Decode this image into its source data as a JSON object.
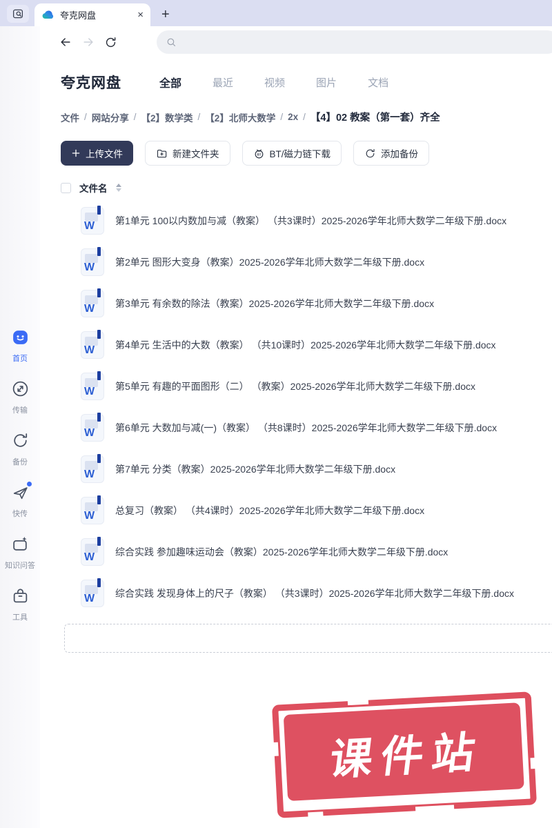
{
  "browser": {
    "tab": {
      "title": "夸克网盘",
      "close": "×"
    },
    "new_tab": "+"
  },
  "header": {
    "brand": "夸克网盘",
    "tabs": [
      {
        "label": "全部",
        "active": true
      },
      {
        "label": "最近",
        "active": false
      },
      {
        "label": "视频",
        "active": false
      },
      {
        "label": "图片",
        "active": false
      },
      {
        "label": "文档",
        "active": false
      }
    ]
  },
  "breadcrumb": {
    "separator": "/",
    "items": [
      "文件",
      "网站分享",
      "【2】数学类",
      "【2】北师大数学",
      "2x"
    ],
    "current": "【4】02 教案（第一套）齐全"
  },
  "actions": {
    "upload": "上传文件",
    "new_folder": "新建文件夹",
    "bt_download": "BT/磁力链下载",
    "add_backup": "添加备份"
  },
  "file_list": {
    "column_name": "文件名",
    "icon_letter": "W",
    "files": [
      "第1单元 100以内数加与减（教案） （共3课时）2025-2026学年北师大数学二年级下册.docx",
      "第2单元 图形大变身（教案）2025-2026学年北师大数学二年级下册.docx",
      "第3单元 有余数的除法（教案）2025-2026学年北师大数学二年级下册.docx",
      "第4单元 生活中的大数（教案） （共10课时）2025-2026学年北师大数学二年级下册.docx",
      "第5单元 有趣的平面图形（二） （教案）2025-2026学年北师大数学二年级下册.docx",
      "第6单元 大数加与减(一)（教案） （共8课时）2025-2026学年北师大数学二年级下册.docx",
      "第7单元 分类（教案）2025-2026学年北师大数学二年级下册.docx",
      "总复习（教案） （共4课时）2025-2026学年北师大数学二年级下册.docx",
      "综合实践 参加趣味运动会（教案）2025-2026学年北师大数学二年级下册.docx",
      "综合实践 发现身体上的尺子（教案） （共3课时）2025-2026学年北师大数学二年级下册.docx"
    ]
  },
  "sidebar": {
    "items": [
      {
        "label": "首页",
        "active": true
      },
      {
        "label": "传输",
        "active": false
      },
      {
        "label": "备份",
        "active": false
      },
      {
        "label": "快传",
        "active": false
      },
      {
        "label": "知识问答",
        "active": false
      },
      {
        "label": "工具",
        "active": false
      }
    ]
  },
  "stamp": {
    "text": "课件站"
  },
  "colors": {
    "accent": "#3b6bf5",
    "primary_button": "#323a59",
    "stamp_red": "#de5161",
    "tab_bar": "#dbdef2"
  }
}
